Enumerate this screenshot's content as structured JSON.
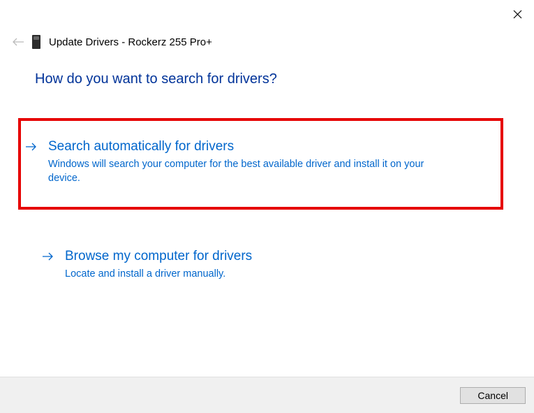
{
  "header": {
    "title": "Update Drivers - Rockerz 255 Pro+"
  },
  "question": "How do you want to search for drivers?",
  "options": [
    {
      "title": "Search automatically for drivers",
      "description": "Windows will search your computer for the best available driver and install it on your device."
    },
    {
      "title": "Browse my computer for drivers",
      "description": "Locate and install a driver manually."
    }
  ],
  "footer": {
    "cancel_label": "Cancel"
  }
}
